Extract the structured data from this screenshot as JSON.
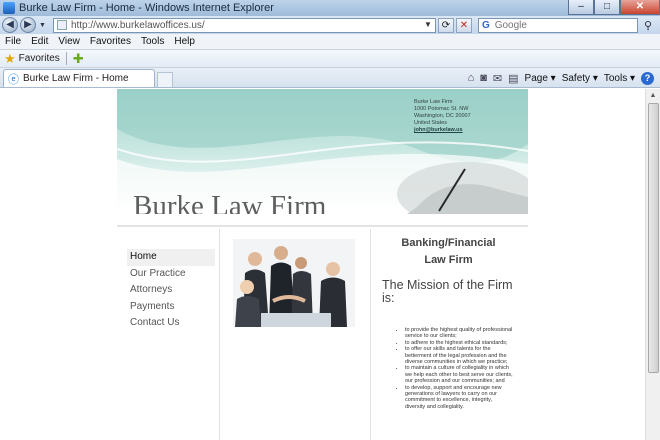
{
  "window": {
    "title": "Burke Law Firm - Home - Windows Internet Explorer",
    "minimize": "–",
    "maximize": "□",
    "close": "✕"
  },
  "addressbar": {
    "url": "http://www.burkelawoffices.us/",
    "search_placeholder": "Google"
  },
  "menu": [
    "File",
    "Edit",
    "View",
    "Favorites",
    "Tools",
    "Help"
  ],
  "favorites": {
    "label": "Favorites"
  },
  "tab": {
    "label": "Burke Law Firm - Home"
  },
  "commandbar": {
    "page": "Page ▾",
    "safety": "Safety ▾",
    "tools": "Tools ▾"
  },
  "site": {
    "contact": {
      "line1": "Burke Law Firm",
      "line2": "1000 Potomac St. NW",
      "line3": "Washington, DC 20007",
      "line4": "United States",
      "email": "john@burkelaw.us"
    },
    "firm_name": "Burke Law Firm",
    "nav": [
      "Home",
      "Our Practice",
      "Attorneys",
      "Payments",
      "Contact Us"
    ],
    "subtitle_line1": "Banking/Financial",
    "subtitle_line2": "Law Firm",
    "mission_title": "The Mission of the Firm is:",
    "mission_items": [
      "to provide the highest quality of professional service to our clients;",
      "to adhere to the highest ethical standards;",
      "to offer our skills and talents for the betterment of the legal profession and the diverse communities in which we practice;",
      "to maintain a culture of collegiality in which we help each other to best serve our clients, our profession and our communities; and",
      "to develop, support and encourage new generations of lawyers to carry on our commitment to excellence, integrity, diversity and collegiality."
    ]
  },
  "colors": {
    "banner_teal": "#a7d7cf",
    "firm_name_gray": "#5e5e5e",
    "ie_chrome_blue": "#c5d7ec"
  }
}
